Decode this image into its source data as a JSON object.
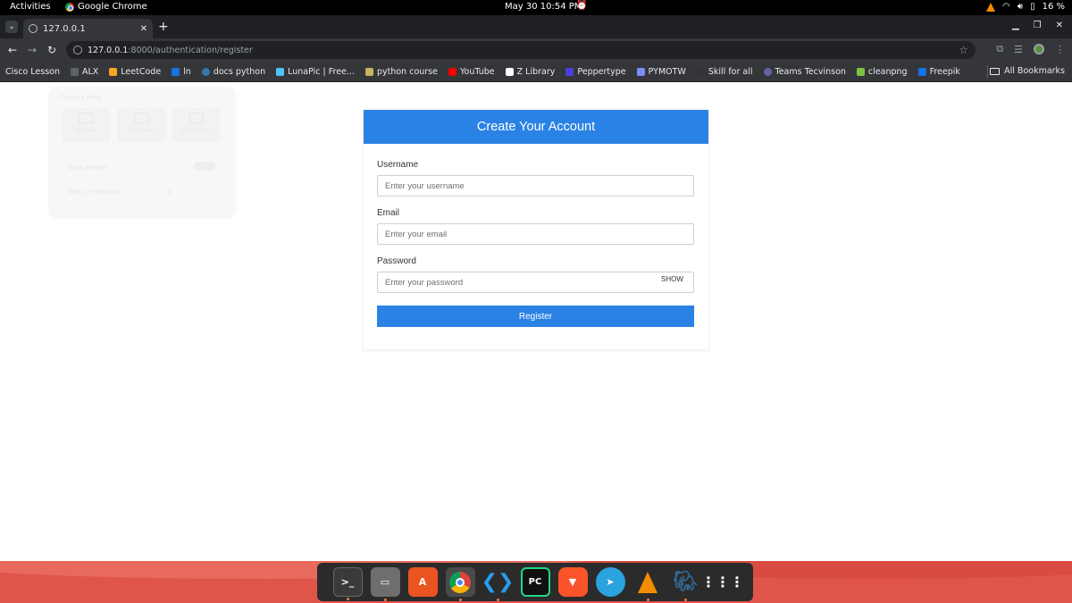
{
  "system": {
    "activities": "Activities",
    "app_name": "Google Chrome",
    "clock": "May 30  10:54 PM",
    "battery": "16 %"
  },
  "browser": {
    "tab_title": "127.0.0.1",
    "url_host": "127.0.0.1",
    "url_path": ":8000/authentication/register",
    "bookmarks": [
      {
        "label": "Cisco Lesson",
        "color": "#ffffff"
      },
      {
        "label": "ALX",
        "color": "#9aa0a6"
      },
      {
        "label": "LeetCode",
        "color": "#f5a623"
      },
      {
        "label": "ln",
        "color": "#1a73e8"
      },
      {
        "label": "docs python",
        "color": "#3776ab"
      },
      {
        "label": "LunaPic | Free...",
        "color": "#4fc3f7"
      },
      {
        "label": "python course",
        "color": "#c8b560"
      },
      {
        "label": "YouTube",
        "color": "#ff0000"
      },
      {
        "label": "Z Library",
        "color": "#ffffff"
      },
      {
        "label": "Peppertype",
        "color": "#4b3fe0"
      },
      {
        "label": "PYMOTW",
        "color": "#7c8cf8"
      },
      {
        "label": "Skill for all",
        "color": "#333333"
      },
      {
        "label": "Teams Tecvinson",
        "color": "#6264a7"
      },
      {
        "label": "cleanpng",
        "color": "#7cc242"
      },
      {
        "label": "Freepik",
        "color": "#1273eb"
      }
    ],
    "all_bookmarks": "All Bookmarks"
  },
  "ghost_widget": {
    "title": "Capture Area",
    "options": [
      "Screen",
      "Window",
      "Selection"
    ],
    "show_pointer": "Show Pointer",
    "delay": "Delay in Seconds",
    "delay_value": "0"
  },
  "form": {
    "title": "Create Your Account",
    "username_label": "Username",
    "username_placeholder": "Enter your username",
    "email_label": "Email",
    "email_placeholder": "Enter your email",
    "password_label": "Password",
    "password_placeholder": "Enter your password",
    "show_label": "SHOW",
    "register_label": "Register"
  },
  "dock": {
    "apps": [
      "terminal",
      "files",
      "app-center",
      "chrome",
      "vscode",
      "pycharm",
      "brave",
      "telegram",
      "vlc",
      "pgadmin",
      "show-apps"
    ]
  },
  "colors": {
    "primary": "#2a82e4",
    "chrome_dark": "#35363a",
    "wallpaper": "#e0554a"
  }
}
